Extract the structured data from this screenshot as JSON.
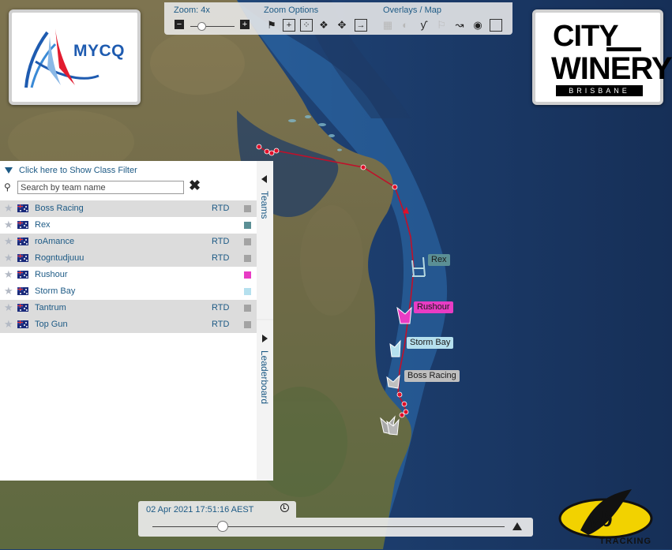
{
  "toolbar": {
    "zoom_label": "Zoom: 4x",
    "zoom_options_label": "Zoom Options",
    "overlays_label": "Overlays / Map",
    "minus": "−",
    "plus": "+"
  },
  "logos": {
    "mycq": "MYCQ",
    "city_winery_line1": "CITY",
    "city_winery_line2": "WINERY",
    "city_winery_sub": "BRISBANE",
    "yb": "TRACKING"
  },
  "panel": {
    "filter_label": "Click here to Show Class Filter",
    "search_placeholder": "Search by team name",
    "clear_icon": "✖",
    "teams_tab": "Teams",
    "leaderboard_tab": "Leaderboard"
  },
  "teams": [
    {
      "name": "Boss Racing",
      "status": "RTD",
      "color": "#a3a3a3",
      "row_bg": "#dcdcdc"
    },
    {
      "name": "Rex",
      "status": "",
      "color": "#5b8f95",
      "row_bg": "#ffffff"
    },
    {
      "name": "roAmance",
      "status": "RTD",
      "color": "#a3a3a3",
      "row_bg": "#dcdcdc"
    },
    {
      "name": "Rogntudjuuu",
      "status": "RTD",
      "color": "#a3a3a3",
      "row_bg": "#dcdcdc"
    },
    {
      "name": "Rushour",
      "status": "",
      "color": "#e83cc4",
      "row_bg": "#ffffff"
    },
    {
      "name": "Storm Bay",
      "status": "",
      "color": "#b5e0ee",
      "row_bg": "#ffffff"
    },
    {
      "name": "Tantrum",
      "status": "RTD",
      "color": "#a3a3a3",
      "row_bg": "#dcdcdc"
    },
    {
      "name": "Top Gun",
      "status": "RTD",
      "color": "#a3a3a3",
      "row_bg": "#dcdcdc"
    }
  ],
  "map_labels": [
    {
      "name": "Rex",
      "color": "#5b8f95",
      "text_color": "#1a1a1a"
    },
    {
      "name": "Rushour",
      "color": "#e83cc4",
      "text_color": "#1a1a1a"
    },
    {
      "name": "Storm Bay",
      "color": "#b5e0ee",
      "text_color": "#1a1a1a"
    },
    {
      "name": "Boss Racing",
      "color": "#bfbfbf",
      "text_color": "#1a1a1a"
    }
  ],
  "timeline": {
    "datetime": "02 Apr 2021 17:51:16 AEST",
    "progress": 0.2
  },
  "colors": {
    "accent": "#1d5a85",
    "track": "#c0102a",
    "ocean": "#1d3f6e"
  }
}
